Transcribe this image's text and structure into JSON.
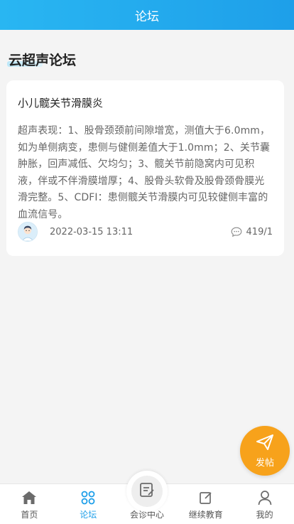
{
  "header": {
    "title": "论坛"
  },
  "section": {
    "title": "云超声论坛"
  },
  "post": {
    "title": "小儿髋关节滑膜炎",
    "body": "超声表现：1、股骨颈颈前间隙增宽，测值大于6.0mm，如为单侧病变，患侧与健侧差值大于1.0mm；2、关节囊肿胀，回声减低、欠均匀；3、髋关节前隐窝内可见积液，伴或不伴滑膜增厚；4、股骨头软骨及股骨颈骨膜光滑完整。5、CDFI：患侧髋关节滑膜内可见较健侧丰富的血流信号。",
    "date": "2022-03-15 13:11",
    "stats": "419/1",
    "avatar_icon": "doctor-avatar-icon",
    "comment_icon": "comment-bubble-icon"
  },
  "fab": {
    "label": "发帖",
    "icon": "paper-plane-icon",
    "color": "#f7a21b"
  },
  "nav": {
    "items": [
      {
        "label": "首页",
        "icon": "home-icon"
      },
      {
        "label": "论坛",
        "icon": "grid-icon",
        "active": true
      },
      {
        "label": "会诊中心",
        "icon": "edit-note-icon"
      },
      {
        "label": "继续教育",
        "icon": "edit-square-icon"
      },
      {
        "label": "我的",
        "icon": "user-icon"
      }
    ]
  },
  "colors": {
    "primary": "#1e9fe9",
    "accent": "#f7a21b"
  }
}
